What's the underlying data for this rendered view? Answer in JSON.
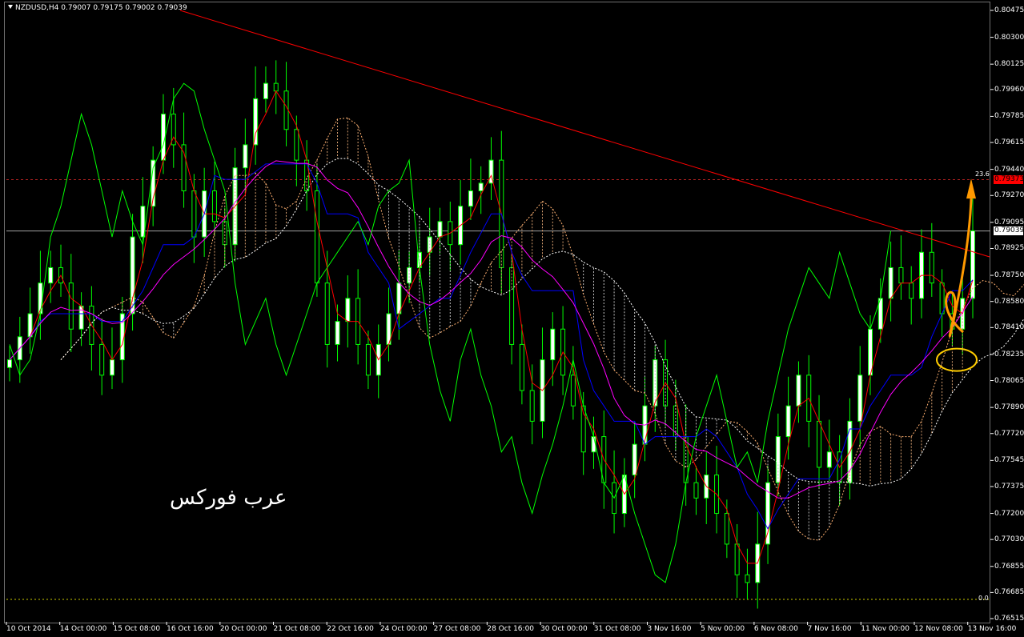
{
  "header": {
    "symbol_line": "NZDUSD,H4  0.79007 0.79175 0.79002 0.79039"
  },
  "watermark": "عرب فوركس",
  "fibo_labels": {
    "top": "23.6",
    "bottom": "0.0"
  },
  "price_boxes": {
    "fibo_level": "0.79373",
    "current": "0.79039"
  },
  "colors": {
    "background": "#000000",
    "bull_candle": "#ffffff",
    "candle_outline": "#00ff00",
    "tenkan": "#ff0000",
    "kijun": "#0000ff",
    "chikou": "#00ff00",
    "sma": "#ff00ff",
    "trendline": "#ff0000",
    "annotation": "#ff9900",
    "ellipse": "#ffcc00"
  },
  "chart_data": {
    "type": "candlestick",
    "symbol": "NZDUSD",
    "timeframe": "H4",
    "y_ticks": [
      "0.80475",
      "0.80300",
      "0.80125",
      "0.79960",
      "0.79785",
      "0.79615",
      "0.79440",
      "0.79270",
      "0.79095",
      "0.78925",
      "0.78750",
      "0.78580",
      "0.78410",
      "0.78235",
      "0.78065",
      "0.77890",
      "0.77720",
      "0.77545",
      "0.77375",
      "0.77200",
      "0.77030",
      "0.76855",
      "0.76685",
      "0.76515"
    ],
    "x_ticks": [
      "10 Oct 2014",
      "14 Oct 00:00",
      "15 Oct 08:00",
      "16 Oct 16:00",
      "20 Oct 00:00",
      "21 Oct 08:00",
      "22 Oct 16:00",
      "24 Oct 00:00",
      "27 Oct 08:00",
      "28 Oct 16:00",
      "30 Oct 00:00",
      "31 Oct 08:00",
      "3 Nov 16:00",
      "5 Nov 00:00",
      "6 Nov 08:00",
      "7 Nov 16:00",
      "11 Nov 00:00",
      "12 Nov 08:00",
      "13 Nov 16:00"
    ],
    "ylim": [
      0.76515,
      0.80475
    ],
    "current_price": 0.79039,
    "fibo_levels": [
      {
        "label": "23.6",
        "price": 0.79373
      },
      {
        "label": "0.0",
        "price": 0.7664
      }
    ],
    "candles_close": [
      0.782,
      0.7835,
      0.785,
      0.787,
      0.788,
      0.787,
      0.784,
      0.7855,
      0.783,
      0.781,
      0.782,
      0.785,
      0.79,
      0.792,
      0.795,
      0.798,
      0.796,
      0.793,
      0.79,
      0.793,
      0.791,
      0.7895,
      0.7945,
      0.796,
      0.799,
      0.8,
      0.7995,
      0.797,
      0.795,
      0.793,
      0.787,
      0.783,
      0.7845,
      0.786,
      0.783,
      0.781,
      0.783,
      0.785,
      0.787,
      0.788,
      0.789,
      0.79,
      0.791,
      0.7895,
      0.792,
      0.793,
      0.7935,
      0.795,
      0.788,
      0.783,
      0.78,
      0.778,
      0.782,
      0.784,
      0.781,
      0.779,
      0.776,
      0.777,
      0.774,
      0.772,
      0.7745,
      0.7765,
      0.779,
      0.782,
      0.779,
      0.777,
      0.774,
      0.773,
      0.7745,
      0.772,
      0.77,
      0.768,
      0.7675,
      0.77,
      0.774,
      0.777,
      0.779,
      0.781,
      0.778,
      0.775,
      0.776,
      0.774,
      0.778,
      0.781,
      0.784,
      0.786,
      0.788,
      0.787,
      0.786,
      0.789,
      0.787,
      0.785,
      0.784,
      0.786,
      0.7904
    ]
  }
}
